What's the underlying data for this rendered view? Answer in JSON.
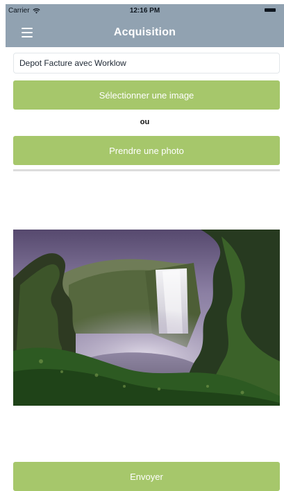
{
  "status_bar": {
    "carrier": "Carrier",
    "time": "12:16 PM"
  },
  "nav": {
    "title": "Acquisition"
  },
  "form": {
    "title_value": "Depot Facture avec Worklow"
  },
  "buttons": {
    "select_image": "Sélectionner une image",
    "separator": "ou",
    "take_photo": "Prendre une photo",
    "send": "Envoyer"
  },
  "colors": {
    "header": "#91a2b1",
    "button": "#a6c76b"
  },
  "icons": {
    "menu": "hamburger-menu-icon",
    "wifi": "wifi-icon",
    "battery": "battery-icon"
  }
}
